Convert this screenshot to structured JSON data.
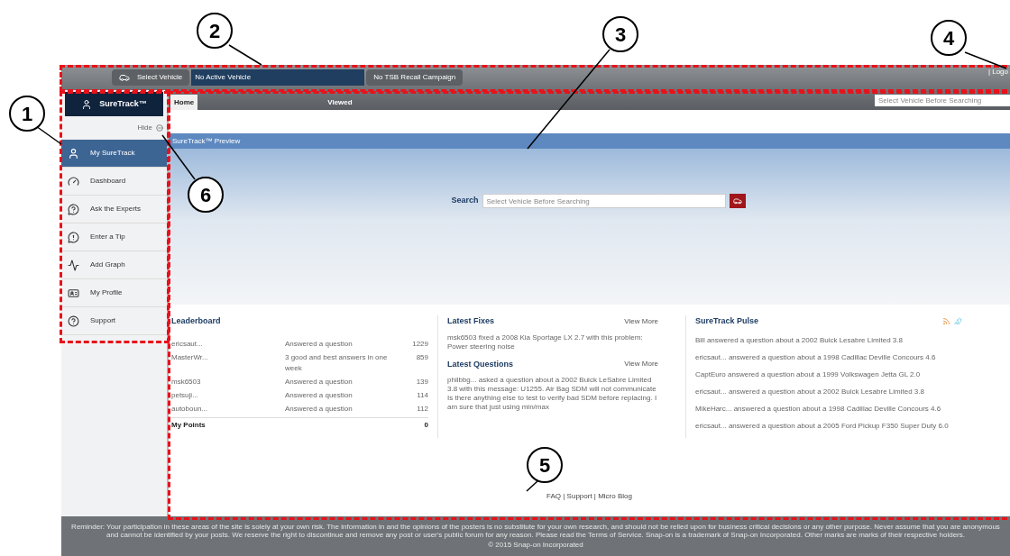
{
  "header": {
    "select_vehicle": "Select Vehicle",
    "active_vehicle": "No Active Vehicle",
    "recall_button": "No TSB Recall Campaign",
    "logout": "| Logo"
  },
  "sidebar": {
    "brand": "SureTrack™",
    "hide": "Hide",
    "items": [
      {
        "label": "My SureTrack",
        "selected": true
      },
      {
        "label": "Dashboard",
        "selected": false
      },
      {
        "label": "Ask the Experts",
        "selected": false
      },
      {
        "label": "Enter a Tip",
        "selected": false
      },
      {
        "label": "Add Graph",
        "selected": false
      },
      {
        "label": "My Profile",
        "selected": false
      },
      {
        "label": "Support",
        "selected": false
      }
    ]
  },
  "tabs": [
    {
      "label": "Home",
      "selected": true
    },
    {
      "label": "Viewed",
      "selected": false
    }
  ],
  "top_search": {
    "placeholder": "Select Vehicle Before Searching"
  },
  "preview": {
    "title": "SureTrack™ Preview",
    "search_label": "Search",
    "search_placeholder": "Select Vehicle Before Searching"
  },
  "leaderboard": {
    "title": "Leaderboard",
    "rows": [
      {
        "user": "ericsaut...",
        "activity": "Answered a question",
        "points": "1229"
      },
      {
        "user": "MasterWr...",
        "activity": "3 good and best answers in one week",
        "points": "859"
      },
      {
        "user": "msk6503",
        "activity": "Answered a question",
        "points": "139"
      },
      {
        "user": "petsuji...",
        "activity": "Answered a question",
        "points": "114"
      },
      {
        "user": "autoboun...",
        "activity": "Answered a question",
        "points": "112"
      }
    ],
    "my_points_label": "My Points",
    "my_points": "0"
  },
  "latest_fixes": {
    "title": "Latest Fixes",
    "view_more": "View More",
    "text": "msk6503 fixed a 2008 Kia Sportage LX 2.7 with this problem: Power steering noise"
  },
  "latest_questions": {
    "title": "Latest Questions",
    "view_more": "View More",
    "text": "philbbg... asked a question about a 2002 Buick LeSabre Limited 3.8 with this message: U1255. Air Bag SDM will not communicate Is there anything else to test to verify bad SDM before replacing. I am sure that just using min/max"
  },
  "pulse": {
    "title": "SureTrack Pulse",
    "items": [
      "Bill answered a question about a 2002 Buick Lesabre Limited 3.8",
      "ericsaut... answered a question about a 1998 Cadillac Deville Concours 4.6",
      "CaptEuro answered a question about a 1999 Volkswagen Jetta GL 2.0",
      "ericsaut... answered a question about a 2002 Buick Lesabre Limited 3.8",
      "MikeHarc... answered a question about a 1998 Cadillac Deville Concours 4.6",
      "ericsaut... answered a question about a 2005 Ford Pickup F350 Super Duty 6.0"
    ]
  },
  "footer_links": "FAQ | Support | Micro Blog",
  "disclaimer": "Reminder: Your participation in these areas of the site is solely at your own risk. The information in and the opinions of the posters is no substitute for your own research, and should not be relied upon for business critical decisions or any other purpose. Never assume that you are anonymous and cannot be identified by your posts. We reserve the right to discontinue and remove any post or user's public forum for any reason. Please read the Terms of Service. Snap-on is a trademark of Snap-on Incorporated. Other marks are marks of their respective holders.",
  "copyright": "© 2015 Snap-on Incorporated",
  "callouts": [
    "1",
    "2",
    "3",
    "4",
    "5",
    "6"
  ]
}
